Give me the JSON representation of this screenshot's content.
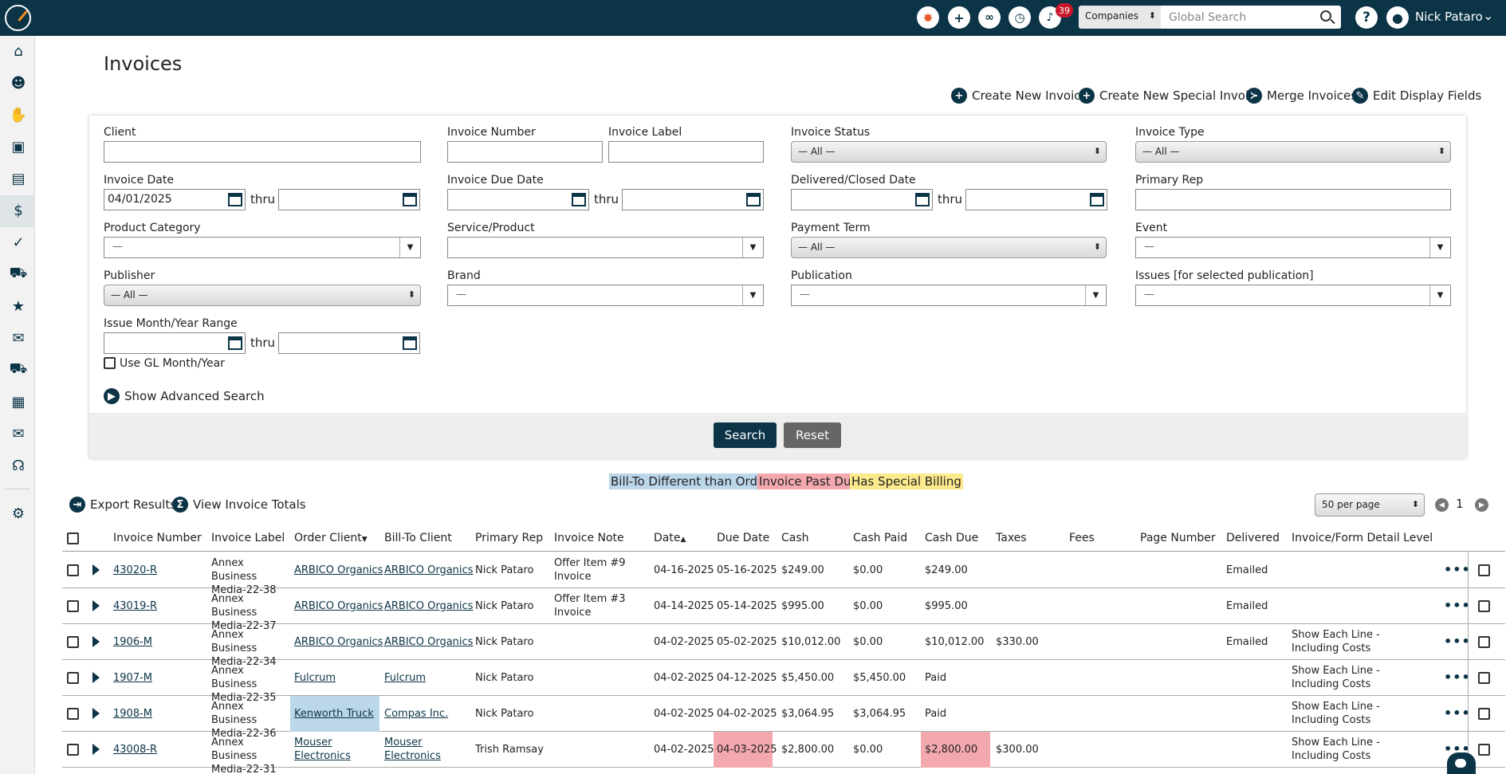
{
  "topbar": {
    "notification_count": "39",
    "search_scope": "Companies",
    "search_placeholder": "Global Search",
    "user_name": "Nick Pataro"
  },
  "page": {
    "title": "Invoices"
  },
  "actions": {
    "create_invoice": "Create New Invoice",
    "create_special": "Create New Special Invoice",
    "merge": "Merge Invoices",
    "edit_fields": "Edit Display Fields"
  },
  "filters": {
    "client": "Client",
    "invoice_number": "Invoice Number",
    "invoice_label": "Invoice Label",
    "invoice_status": "Invoice Status",
    "invoice_status_value": "— All —",
    "invoice_type": "Invoice Type",
    "invoice_type_value": "— All —",
    "invoice_date": "Invoice Date",
    "invoice_date_from": "04/01/2025",
    "thru": "thru",
    "invoice_due_date": "Invoice Due Date",
    "delivered_closed_date": "Delivered/Closed Date",
    "primary_rep": "Primary Rep",
    "product_category": "Product Category",
    "product_category_value": "—",
    "service_product": "Service/Product",
    "payment_term": "Payment Term",
    "payment_term_value": "— All —",
    "event": "Event",
    "event_value": "—",
    "publisher": "Publisher",
    "publisher_value": "— All —",
    "brand": "Brand",
    "brand_value": "—",
    "publication": "Publication",
    "publication_value": "—",
    "issues": "Issues [for selected publication]",
    "issues_value": "—",
    "issue_month_range": "Issue Month/Year Range",
    "use_gl": "Use GL Month/Year",
    "advanced": "Show Advanced Search",
    "search_btn": "Search",
    "reset_btn": "Reset"
  },
  "legend": {
    "bill_to": "Bill-To Different than Order",
    "past_due": "Invoice Past Due",
    "special": "Has Special Billing",
    "colors": {
      "bill_to": "#bcd6ea",
      "past_due": "#f3a8ae",
      "special": "#fbe98c"
    }
  },
  "results": {
    "export": "Export Results",
    "totals": "View Invoice Totals",
    "per_page": "50 per page",
    "page": "1"
  },
  "table": {
    "headers": {
      "invoice_number": "Invoice Number",
      "invoice_label": "Invoice Label",
      "order_client": "Order Client",
      "bill_to_client": "Bill-To Client",
      "primary_rep": "Primary Rep",
      "invoice_note": "Invoice Note",
      "date": "Date",
      "due_date": "Due Date",
      "cash": "Cash",
      "cash_paid": "Cash Paid",
      "cash_due": "Cash Due",
      "taxes": "Taxes",
      "fees": "Fees",
      "page_number": "Page Number",
      "delivered": "Delivered",
      "detail_level": "Invoice/Form Detail Level"
    },
    "rows": [
      {
        "number": "43020-R",
        "label": "Annex Business Media-22-38",
        "order_client": "ARBICO Organics",
        "bill_to": "ARBICO Organics",
        "rep": "Nick Pataro",
        "note": "Offer Item #9 Invoice",
        "date": "04-16-2025",
        "due": "05-16-2025",
        "cash": "$249.00",
        "paid": "$0.00",
        "cash_due": "$249.00",
        "taxes": "",
        "delivered": "Emailed",
        "detail": ""
      },
      {
        "number": "43019-R",
        "label": "Annex Business Media-22-37",
        "order_client": "ARBICO Organics",
        "bill_to": "ARBICO Organics",
        "rep": "Nick Pataro",
        "note": "Offer Item #3 Invoice",
        "date": "04-14-2025",
        "due": "05-14-2025",
        "cash": "$995.00",
        "paid": "$0.00",
        "cash_due": "$995.00",
        "taxes": "",
        "delivered": "Emailed",
        "detail": ""
      },
      {
        "number": "1906-M",
        "label": "Annex Business Media-22-34",
        "order_client": "ARBICO Organics",
        "bill_to": "ARBICO Organics",
        "rep": "Nick Pataro",
        "note": "",
        "date": "04-02-2025",
        "due": "05-02-2025",
        "cash": "$10,012.00",
        "paid": "$0.00",
        "cash_due": "$10,012.00",
        "taxes": "$330.00",
        "delivered": "Emailed",
        "detail": "Show Each Line - Including Costs"
      },
      {
        "number": "1907-M",
        "label": "Annex Business Media-22-35",
        "order_client": "Fulcrum",
        "bill_to": "Fulcrum",
        "rep": "Nick Pataro",
        "note": "",
        "date": "04-02-2025",
        "due": "04-12-2025",
        "cash": "$5,450.00",
        "paid": "$5,450.00",
        "cash_due": "Paid",
        "taxes": "",
        "delivered": "",
        "detail": "Show Each Line - Including Costs"
      },
      {
        "number": "1908-M",
        "label": "Annex Business Media-22-36",
        "order_client": "Kenworth Truck",
        "bill_to": "Compas Inc.",
        "rep": "Nick Pataro",
        "note": "",
        "date": "04-02-2025",
        "due": "04-02-2025",
        "cash": "$3,064.95",
        "paid": "$3,064.95",
        "cash_due": "Paid",
        "taxes": "",
        "delivered": "",
        "detail": "Show Each Line - Including Costs"
      },
      {
        "number": "43008-R",
        "label": "Annex Business Media-22-31",
        "order_client": "Mouser Electronics",
        "bill_to": "Mouser Electronics",
        "rep": "Trish Ramsay",
        "note": "",
        "date": "04-02-2025",
        "due": "04-03-2025",
        "cash": "$2,800.00",
        "paid": "$0.00",
        "cash_due": "$2,800.00",
        "taxes": "$300.00",
        "delivered": "",
        "detail": "Show Each Line - Including Costs"
      }
    ]
  }
}
